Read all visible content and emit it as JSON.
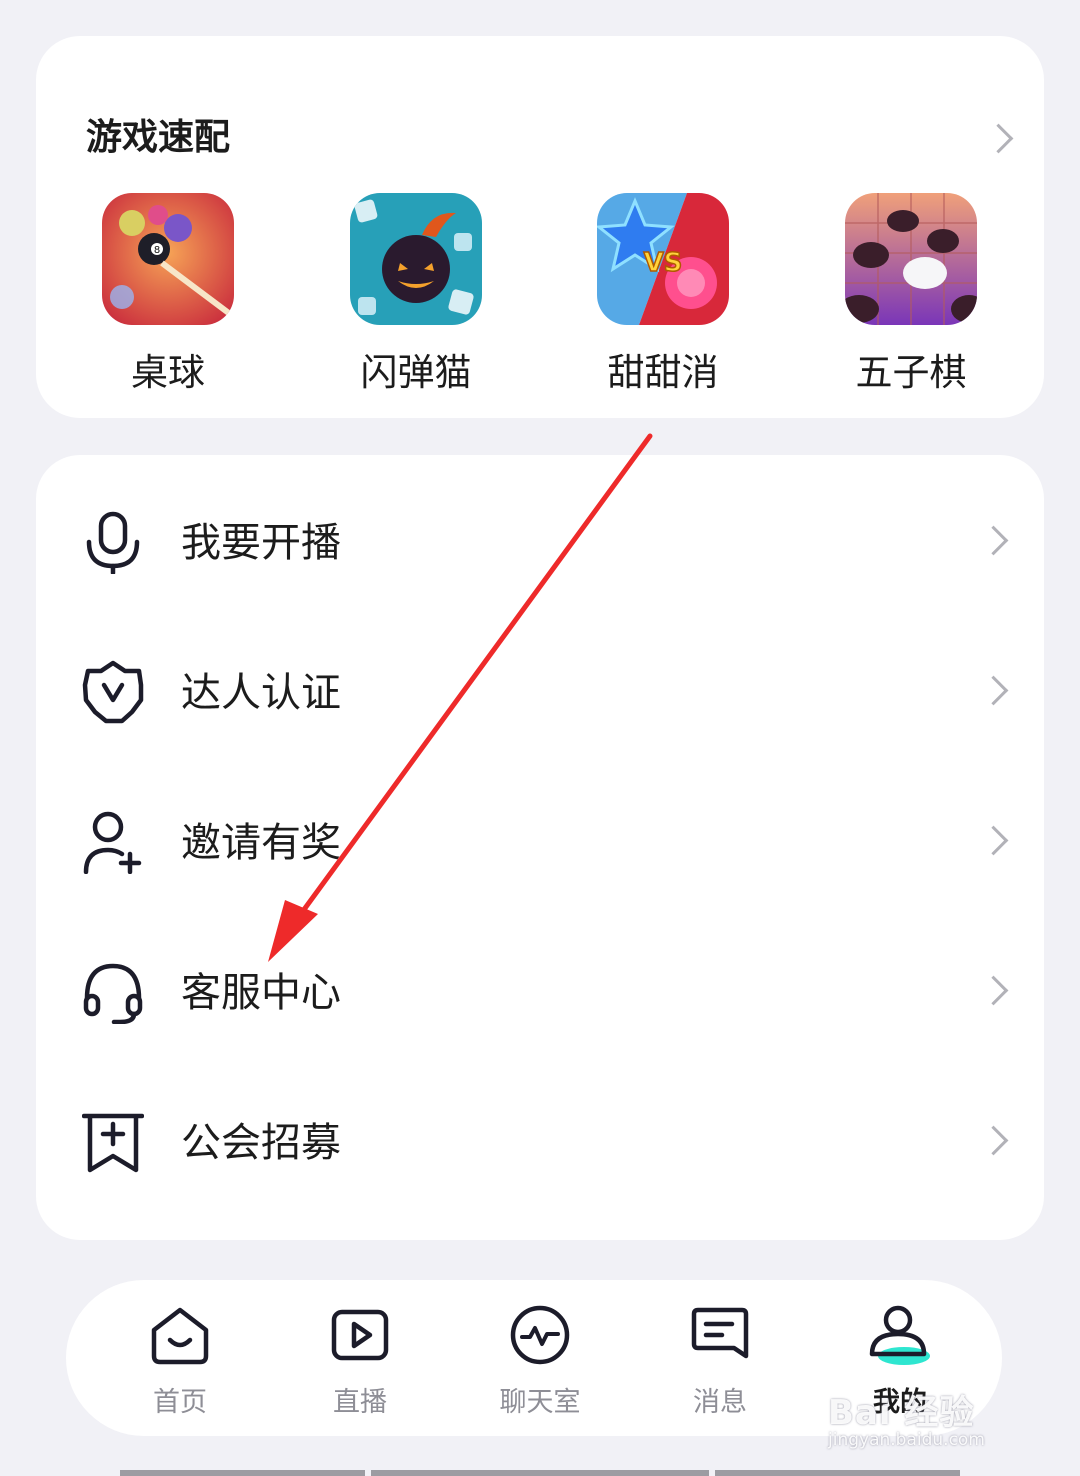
{
  "games": {
    "title": "游戏速配",
    "items": [
      {
        "label": "桌球",
        "icon": "billiards-icon"
      },
      {
        "label": "闪弹猫",
        "icon": "bomb-cat-icon"
      },
      {
        "label": "甜甜消",
        "icon": "sweet-match-icon"
      },
      {
        "label": "五子棋",
        "icon": "gomoku-icon"
      }
    ]
  },
  "menu": {
    "items": [
      {
        "label": "我要开播",
        "icon": "microphone-icon"
      },
      {
        "label": "达人认证",
        "icon": "verified-badge-icon"
      },
      {
        "label": "邀请有奖",
        "icon": "add-user-icon"
      },
      {
        "label": "客服中心",
        "icon": "headset-icon"
      },
      {
        "label": "公会招募",
        "icon": "bookmark-plus-icon"
      }
    ]
  },
  "tabbar": {
    "items": [
      {
        "label": "首页",
        "icon": "home-icon"
      },
      {
        "label": "直播",
        "icon": "play-icon"
      },
      {
        "label": "聊天室",
        "icon": "pulse-icon"
      },
      {
        "label": "消息",
        "icon": "message-icon"
      },
      {
        "label": "我的",
        "icon": "profile-icon",
        "active": true
      }
    ]
  },
  "watermark": {
    "line1": "Bai 经验",
    "line2": "jingyan.baidu.com"
  },
  "colors": {
    "background": "#f1f1f6",
    "card": "#ffffff",
    "accent": "#2ee6d0",
    "arrow": "#ee2a2a"
  }
}
